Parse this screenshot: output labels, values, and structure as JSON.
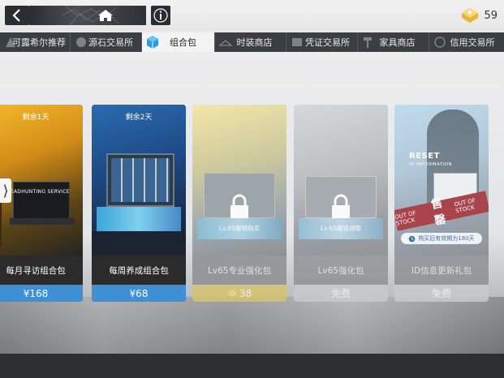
{
  "topbar": {
    "currency_amount": "59",
    "icons": [
      "back-icon",
      "home-icon",
      "info-icon",
      "premium-currency-icon"
    ]
  },
  "tabs": [
    {
      "label": "可露希尔推荐",
      "icon": "recommend-icon",
      "active": false
    },
    {
      "label": "源石交易所",
      "icon": "originium-icon",
      "active": false
    },
    {
      "label": "组合包",
      "icon": "package-icon",
      "active": true
    },
    {
      "label": "时装商店",
      "icon": "hanger-icon",
      "active": false
    },
    {
      "label": "凭证交易所",
      "icon": "voucher-icon",
      "active": false
    },
    {
      "label": "家具商店",
      "icon": "hammer-icon",
      "active": false
    },
    {
      "label": "信用交易所",
      "icon": "credit-icon",
      "active": false
    }
  ],
  "cards": [
    {
      "days_left": "剩余1天",
      "name": "每月寻访组合包",
      "price": "¥168",
      "art_text": "HEADHUNTING SERVICE",
      "state": "available"
    },
    {
      "days_left": "剩余2天",
      "name": "每周养成组合包",
      "price": "¥68",
      "state": "available"
    },
    {
      "name": "Lv65专业强化包",
      "price": "38",
      "lock_text": "Lv.65解锁购买",
      "state": "locked"
    },
    {
      "name": "Lv65强化包",
      "price": "免费",
      "lock_text": "Lv.65解锁领取",
      "state": "locked"
    },
    {
      "name": "ID信息更新礼包",
      "price": "免费",
      "stamp_big": "售罄",
      "stamp_small": "OUT OF STOCK",
      "art_title": "RESET",
      "art_sub": "ID INFORMATION",
      "pill_text": "购买后有效期为180天",
      "state": "sold-out"
    }
  ],
  "colors": {
    "price_blue": "#3e8fd3",
    "gold": "#d7c56a",
    "grey": "#c9cacc",
    "stamp_red": "#a02a34",
    "dark": "#2a2d31"
  }
}
